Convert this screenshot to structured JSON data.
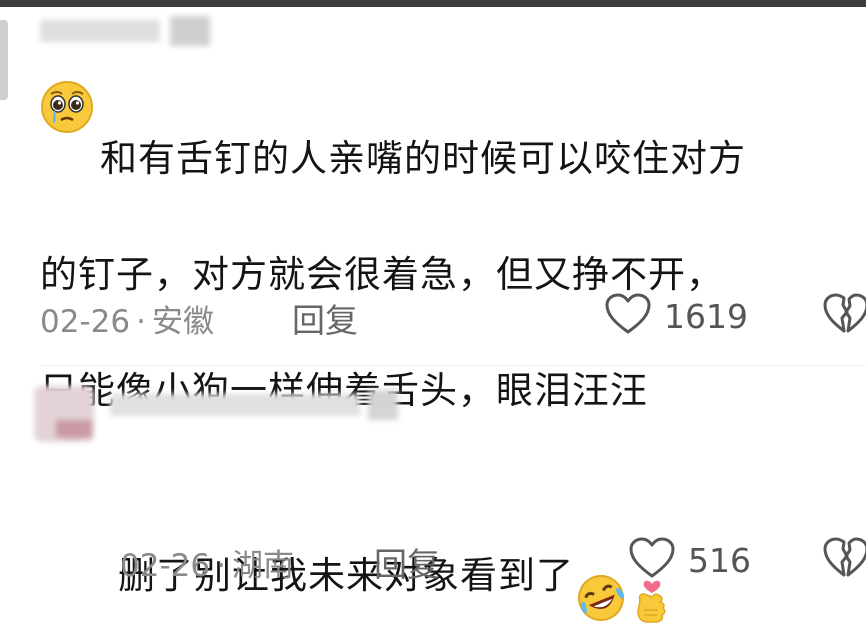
{
  "comments": [
    {
      "text": "和有舌钉的人亲嘴的时候可以咬住对方的钉子，对方就会很着急，但又挣不开，只能像小狗一样伸着舌头，眼泪汪汪",
      "lines": [
        "和有舌钉的人亲嘴的时候可以咬住对方",
        "的钉子，对方就会很着急，但又挣不开，",
        "只能像小狗一样伸着舌头，眼泪汪汪"
      ],
      "leading_emoji": "pleading-face-icon",
      "date": "02-26",
      "location": "安徽",
      "separator": "·",
      "reply_label": "回复",
      "likes": "1619"
    },
    {
      "text": "删了别让我未来对象看到了",
      "trailing_emojis": [
        "rolling-laughing-face-icon",
        "finger-heart-icon"
      ],
      "date": "02-26",
      "location": "湖南",
      "separator": "·",
      "reply_label": "回复",
      "likes": "516"
    }
  ],
  "colors": {
    "text": "#141414",
    "meta": "#8a8a8a",
    "icon": "#555555",
    "heart_pink": "#f26b8a"
  }
}
